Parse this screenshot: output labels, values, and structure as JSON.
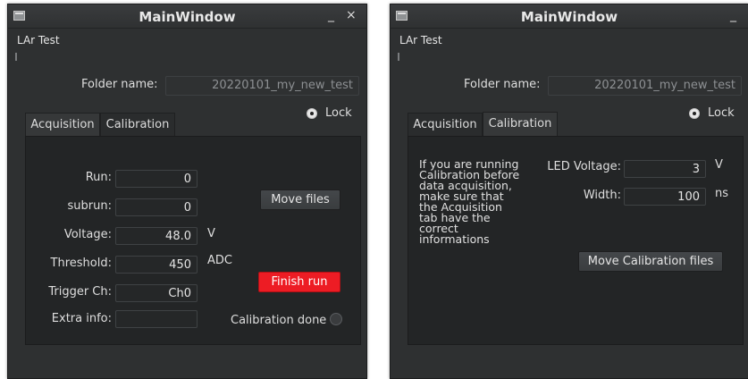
{
  "window_title": "MainWindow",
  "controls": {
    "minimize": "_",
    "close": "×"
  },
  "menu": {
    "item": "LAr Test"
  },
  "folder": {
    "label": "Folder name:",
    "value": "20220101_my_new_test"
  },
  "lock_label": "Lock",
  "tabs": {
    "acquisition": "Acquisition",
    "calibration": "Calibration"
  },
  "acquisition": {
    "run": {
      "label": "Run:",
      "value": "0"
    },
    "subrun": {
      "label": "subrun:",
      "value": "0"
    },
    "voltage": {
      "label": "Voltage:",
      "value": "48.0",
      "unit": "V"
    },
    "threshold": {
      "label": "Threshold:",
      "value": "450",
      "unit": "ADC"
    },
    "trigger": {
      "label": "Trigger Ch:",
      "value": "Ch0"
    },
    "extra": {
      "label": "Extra info:",
      "value": ""
    },
    "move_files": "Move files",
    "finish_run": "Finish run",
    "calibration_done": "Calibration done"
  },
  "calibration": {
    "info_text": "If you are running\nCalibration before\ndata acquisition,\nmake sure that\nthe Acquisition\ntab have the\ncorrect\ninformations",
    "led_voltage": {
      "label": "LED Voltage:",
      "value": "3",
      "unit": "V"
    },
    "width": {
      "label": "Width:",
      "value": "100",
      "unit": "ns"
    },
    "move_calibration_files": "Move Calibration files"
  },
  "colors": {
    "background": "#2e3031",
    "panel": "#232526",
    "finish_button": "#ed1c24"
  }
}
